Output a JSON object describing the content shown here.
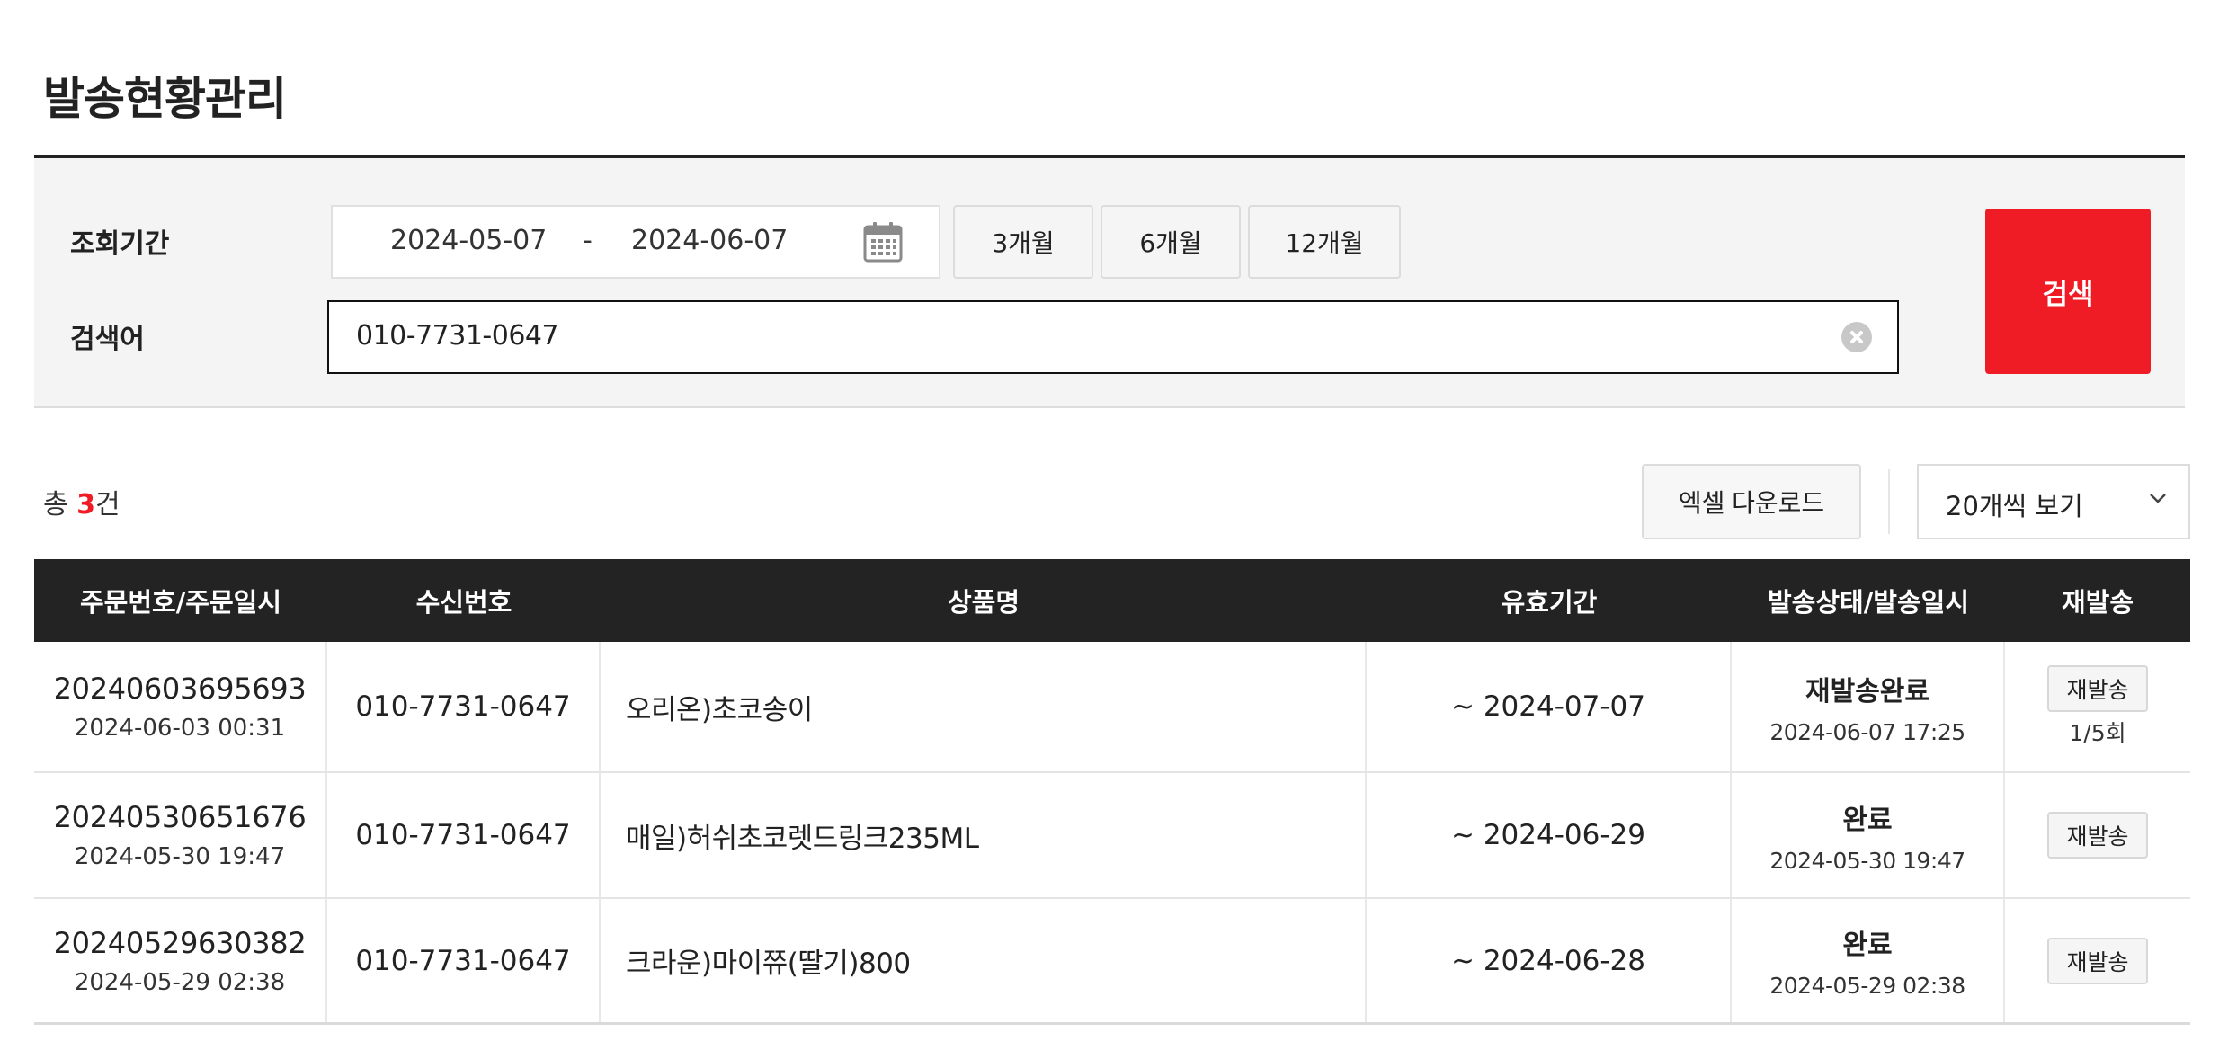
{
  "page": {
    "title": "발송현황관리"
  },
  "search": {
    "period_label": "조회기간",
    "start_date": "2024-05-07",
    "date_separator": "-",
    "end_date": "2024-06-07",
    "period_buttons": [
      "3개월",
      "6개월",
      "12개월"
    ],
    "keyword_label": "검색어",
    "keyword_value": "010-7731-0647",
    "search_button": "검색"
  },
  "summary": {
    "total_prefix": "총 ",
    "total_count": "3",
    "total_suffix": "건",
    "excel_button": "엑셀 다운로드",
    "page_size_value": "20개씩 보기"
  },
  "table": {
    "headers": [
      "주문번호/주문일시",
      "수신번호",
      "상품명",
      "유효기간",
      "발송상태/발송일시",
      "재발송"
    ],
    "rows": [
      {
        "order_no": "20240603695693",
        "order_datetime": "2024-06-03 00:31",
        "phone": "010-7731-0647",
        "product": "오리온)초코송이",
        "valid_until": "~ 2024-07-07",
        "status": "재발송완료",
        "sent_datetime": "2024-06-07 17:25",
        "resend_label": "재발송",
        "resend_count": "1/5회"
      },
      {
        "order_no": "20240530651676",
        "order_datetime": "2024-05-30 19:47",
        "phone": "010-7731-0647",
        "product": "매일)허쉬초코렛드링크235ML",
        "valid_until": "~ 2024-06-29",
        "status": "완료",
        "sent_datetime": "2024-05-30 19:47",
        "resend_label": "재발송"
      },
      {
        "order_no": "20240529630382",
        "order_datetime": "2024-05-29 02:38",
        "phone": "010-7731-0647",
        "product": "크라운)마이쮸(딸기)800",
        "valid_until": "~ 2024-06-28",
        "status": "완료",
        "sent_datetime": "2024-05-29 02:38",
        "resend_label": "재발송"
      }
    ]
  },
  "icons": {
    "calendar": "calendar-icon",
    "clear": "clear-icon",
    "chevron": "chevron-down-icon"
  },
  "colors": {
    "accent": "#ef1c25",
    "header_bg": "#232323",
    "panel_bg": "#f4f4f4"
  }
}
